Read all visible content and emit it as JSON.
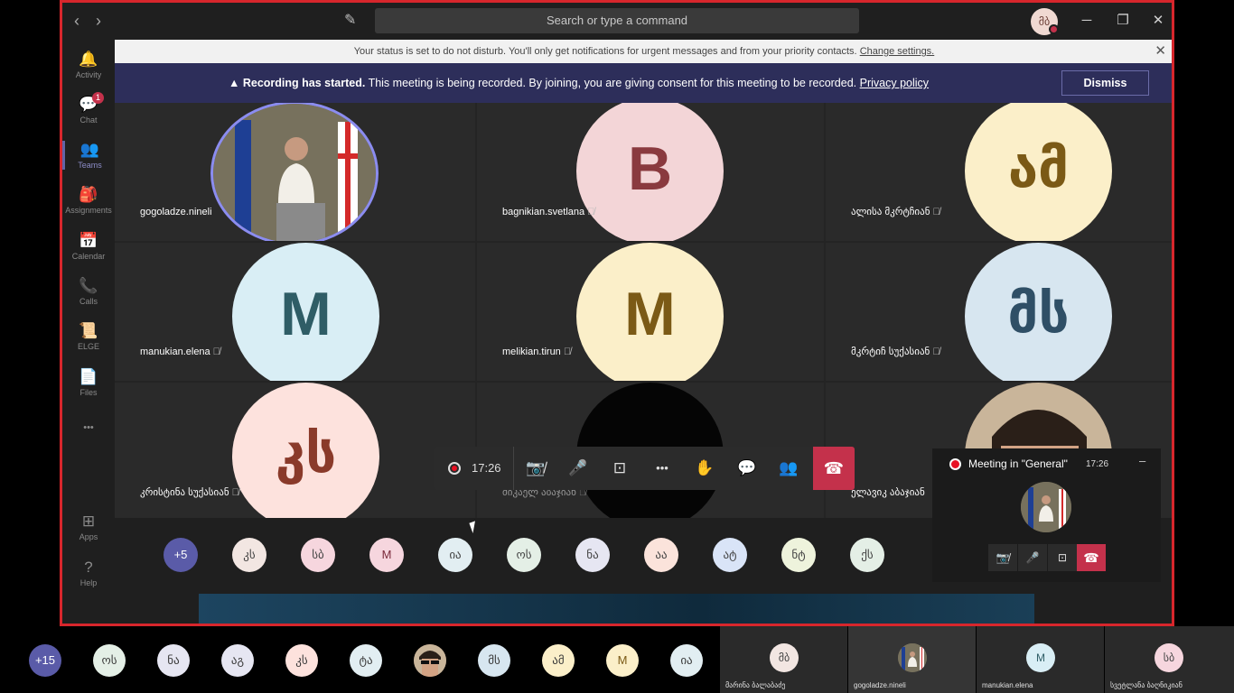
{
  "titlebar": {
    "back_icon": "‹",
    "forward_icon": "›",
    "compose_icon": "✎",
    "search_placeholder": "Search or type a command",
    "me_initials": "მბ",
    "minimize_icon": "─",
    "maximize_icon": "❐",
    "close_icon": "✕"
  },
  "rail": {
    "items": [
      {
        "label": "Activity",
        "icon": "🔔"
      },
      {
        "label": "Chat",
        "icon": "💬",
        "badge": "1"
      },
      {
        "label": "Teams",
        "icon": "👥"
      },
      {
        "label": "Assignments",
        "icon": "🎒"
      },
      {
        "label": "Calendar",
        "icon": "📅"
      },
      {
        "label": "Calls",
        "icon": "📞"
      },
      {
        "label": "ELGE",
        "icon": "📜"
      },
      {
        "label": "Files",
        "icon": "📄"
      },
      {
        "label": "",
        "icon": "•••"
      },
      {
        "label": "Apps",
        "icon": "⊞"
      },
      {
        "label": "Help",
        "icon": "?"
      }
    ]
  },
  "status_banner": {
    "text": "Your status is set to do not disturb. You'll only get notifications for urgent messages and from your priority contacts.",
    "link": "Change settings.",
    "close_icon": "✕"
  },
  "recording_banner": {
    "warning_icon": "▲",
    "bold": "Recording has started.",
    "text": "This meeting is being recorded. By joining, you are giving consent for this meeting to be recorded.",
    "link": "Privacy policy",
    "dismiss": "Dismiss"
  },
  "tiles": [
    {
      "name": "gogoladze.nineli",
      "initials": "",
      "bg": "#6d6650",
      "fg": "#fff",
      "muted": false
    },
    {
      "name": "bagnikian.svetlana",
      "initials": "B",
      "bg": "#f3d5d7",
      "fg": "#8a3a3f",
      "muted": true
    },
    {
      "name": "ალისა მკრტჩიან",
      "initials": "ამ",
      "bg": "#fbefc9",
      "fg": "#7b5a16",
      "muted": true
    },
    {
      "name": "manukian.elena",
      "initials": "M",
      "bg": "#d9eef5",
      "fg": "#2f5d66",
      "muted": true
    },
    {
      "name": "melikian.tirun",
      "initials": "M",
      "bg": "#fbefc9",
      "fg": "#7b5a16",
      "muted": true
    },
    {
      "name": "მკრტიჩ სუქასიან",
      "initials": "მს",
      "bg": "#d7e6f0",
      "fg": "#2f4f66",
      "muted": true
    },
    {
      "name": "კრისტინა სუქასიან",
      "initials": "კს",
      "bg": "#fde2dd",
      "fg": "#8a3a2a",
      "muted": true
    },
    {
      "name": "მიკაელ აბაჯიან",
      "initials": "",
      "bg": "#050505",
      "fg": "#fff",
      "muted": true
    },
    {
      "name": "ელავიკ აბაჯიან",
      "initials": "",
      "bg": "#5d4335",
      "fg": "#fff",
      "muted": false
    }
  ],
  "call_controls": {
    "timer": "17:26",
    "camera_icon": "📷̸",
    "mic_icon": "🎤",
    "share_icon": "⊡",
    "more_icon": "•••",
    "raise_hand_icon": "✋",
    "chat_icon": "💬",
    "participants_icon": "👥",
    "hangup_icon": "☎"
  },
  "roster": [
    {
      "label": "+5",
      "bg": "#5a5ba8",
      "fg": "#fff"
    },
    {
      "label": "კს",
      "bg": "#f2e6e2",
      "fg": "#444"
    },
    {
      "label": "სბ",
      "bg": "#f6d6de",
      "fg": "#444"
    },
    {
      "label": "M",
      "bg": "#f6d6de",
      "fg": "#7a2a3a"
    },
    {
      "label": "ია",
      "bg": "#e2eef2",
      "fg": "#444"
    },
    {
      "label": "ოს",
      "bg": "#e4efe6",
      "fg": "#444"
    },
    {
      "label": "ნა",
      "bg": "#e6e6f2",
      "fg": "#444"
    },
    {
      "label": "აა",
      "bg": "#fbe3db",
      "fg": "#444"
    },
    {
      "label": "ატ",
      "bg": "#d9e4f7",
      "fg": "#444"
    },
    {
      "label": "ნტ",
      "bg": "#eef3dc",
      "fg": "#444"
    },
    {
      "label": "ქს",
      "bg": "#e4efe6",
      "fg": "#444"
    }
  ],
  "mini_window": {
    "title": "Meeting in \"General\"",
    "time": "17:26",
    "minimize_icon": "–",
    "camera_icon": "📷̸",
    "mic_icon": "🎤",
    "share_icon": "⊡",
    "hangup_icon": "☎"
  },
  "bottom_roster": [
    {
      "label": "+15",
      "bg": "#5a5ba8",
      "fg": "#fff"
    },
    {
      "label": "ოს",
      "bg": "#e4efe6",
      "fg": "#444"
    },
    {
      "label": "ნა",
      "bg": "#e6e6f2",
      "fg": "#444"
    },
    {
      "label": "აგ",
      "bg": "#e6e6f2",
      "fg": "#444"
    },
    {
      "label": "კს",
      "bg": "#fde2dd",
      "fg": "#444"
    },
    {
      "label": "ტა",
      "bg": "#e2eef2",
      "fg": "#444"
    },
    {
      "label": "",
      "bg": "#8a6a55",
      "fg": "#fff"
    },
    {
      "label": "მს",
      "bg": "#d7e6f0",
      "fg": "#444"
    },
    {
      "label": "ამ",
      "bg": "#fbefc9",
      "fg": "#444"
    },
    {
      "label": "M",
      "bg": "#fbefc9",
      "fg": "#7b5a16"
    },
    {
      "label": "ია",
      "bg": "#e2eef2",
      "fg": "#444"
    }
  ],
  "side_tiles": [
    {
      "name": "მარინა ბალაბაძე",
      "initials": "მბ",
      "bg": "#f2e6e2",
      "fg": "#444"
    },
    {
      "name": "gogoladze.nineli",
      "initials": "",
      "bg": "#6d6650",
      "fg": "#fff"
    },
    {
      "name": "manukian.elena",
      "initials": "M",
      "bg": "#d9eef5",
      "fg": "#2f5d66"
    },
    {
      "name": "სვეტლანა ბაღნიკიან",
      "initials": "სბ",
      "bg": "#f6d6de",
      "fg": "#444"
    }
  ]
}
